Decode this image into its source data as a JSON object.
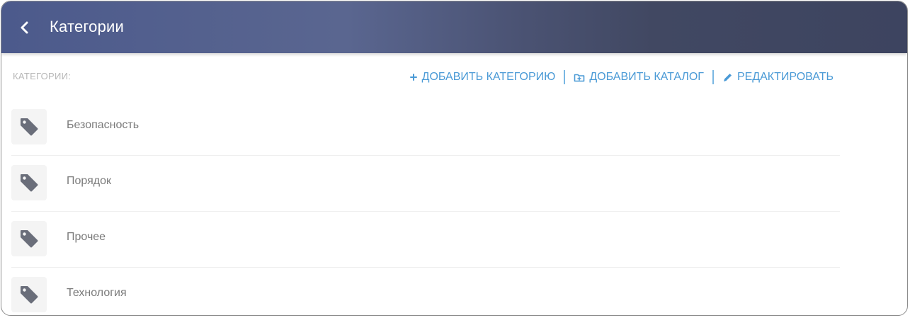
{
  "header": {
    "title": "Категории",
    "back_icon": "chevron-left-icon"
  },
  "section": {
    "label": "КАТЕГОРИИ:"
  },
  "toolbar": {
    "add_category_label": "ДОБАВИТЬ КАТЕГОРИЮ",
    "add_category_icon": "plus-icon",
    "add_catalog_label": "ДОБАВИТЬ КАТАЛОГ",
    "add_catalog_icon": "folder-plus-icon",
    "edit_label": "РЕДАКТИРОВАТЬ",
    "edit_icon": "pencil-icon"
  },
  "categories": [
    {
      "label": "Безопасность",
      "icon": "tag-icon"
    },
    {
      "label": "Порядок",
      "icon": "tag-icon"
    },
    {
      "label": "Прочее",
      "icon": "tag-icon"
    },
    {
      "label": "Технология",
      "icon": "tag-icon"
    }
  ],
  "colors": {
    "header_start": "#4c5a8c",
    "header_end": "#3d4460",
    "accent": "#4a9ad6",
    "icon": "#6a6e7a"
  }
}
